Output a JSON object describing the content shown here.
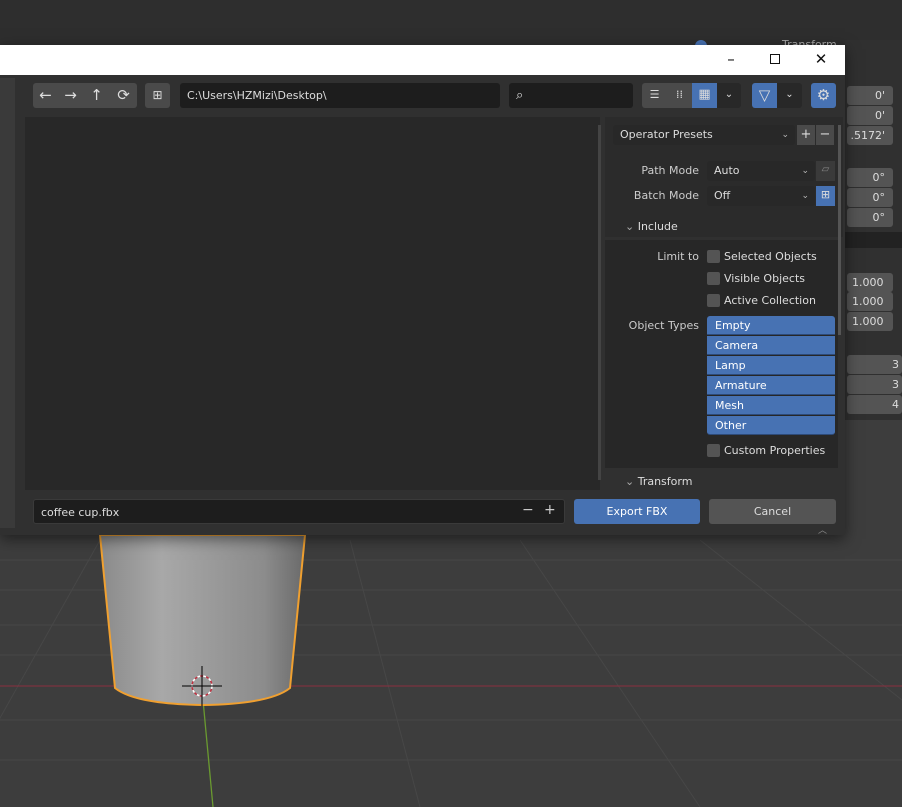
{
  "window": {
    "minimize_icon": "minimize-icon",
    "maximize_icon": "maximize-icon",
    "close_icon": "close-icon"
  },
  "toolbar": {
    "path": "C:\\Users\\HZMizi\\Desktop\\",
    "search_placeholder": "",
    "nav_icons": [
      "back-arrow-icon",
      "forward-arrow-icon",
      "parent-directory-icon",
      "refresh-icon",
      "new-folder-icon"
    ],
    "display_modes": [
      "vertical-list",
      "horizontal-list",
      "thumbnails"
    ],
    "active_display_mode": "thumbnails"
  },
  "panel": {
    "operator_presets": "Operator Presets",
    "path_mode_label": "Path Mode",
    "path_mode_value": "Auto",
    "batch_mode_label": "Batch Mode",
    "batch_mode_value": "Off",
    "include_section": "Include",
    "limit_to_label": "Limit to",
    "limit_options": [
      {
        "label": "Selected Objects",
        "checked": false
      },
      {
        "label": "Visible Objects",
        "checked": false
      },
      {
        "label": "Active Collection",
        "checked": false
      }
    ],
    "object_types_label": "Object Types",
    "object_types": [
      {
        "label": "Empty",
        "selected": true
      },
      {
        "label": "Camera",
        "selected": true
      },
      {
        "label": "Lamp",
        "selected": true
      },
      {
        "label": "Armature",
        "selected": true
      },
      {
        "label": "Mesh",
        "selected": true
      },
      {
        "label": "Other",
        "selected": true
      }
    ],
    "custom_properties": {
      "label": "Custom Properties",
      "checked": false
    },
    "transform_section": "Transform"
  },
  "footer": {
    "filename": "coffee cup.fbx",
    "export_label": "Export FBX",
    "cancel_label": "Cancel"
  },
  "background_panel": {
    "header": "Transform",
    "location": [
      "0'",
      "0'",
      ".5172'"
    ],
    "rotation": [
      "0°",
      "0°",
      "0°"
    ],
    "scale": [
      "1.000",
      "1.000",
      "1.000"
    ],
    "dimensions": [
      "3",
      "3",
      "4"
    ]
  },
  "colors": {
    "accent": "#4772b3",
    "selection_outline": "#f0a030",
    "x_axis": "#a03040",
    "y_axis": "#6a9a30"
  }
}
